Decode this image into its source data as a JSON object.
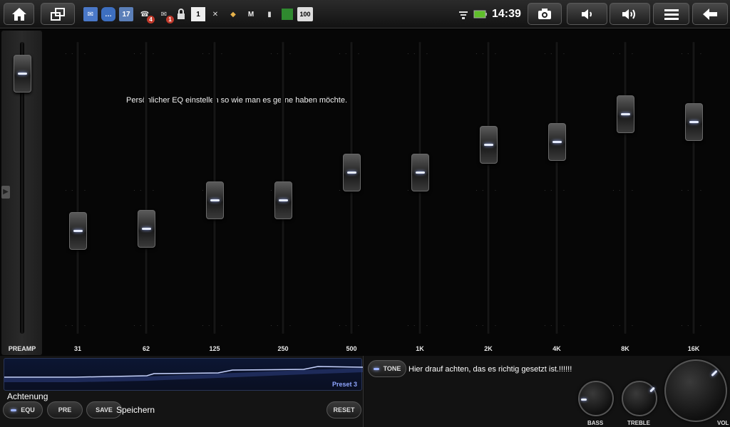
{
  "status_bar": {
    "clock": "14:39",
    "battery_level": "100",
    "notifications": [
      {
        "icon": "email-icon",
        "badge": ""
      },
      {
        "icon": "chat-icon",
        "badge": ""
      },
      {
        "icon": "calendar-icon",
        "badge": ""
      },
      {
        "icon": "missed-call-icon",
        "badge": "4"
      },
      {
        "icon": "message-icon",
        "badge": "1"
      },
      {
        "icon": "lock-icon",
        "badge": ""
      },
      {
        "icon": "box-icon",
        "badge": ""
      },
      {
        "icon": "voicemail-icon",
        "badge": ""
      },
      {
        "icon": "package-icon",
        "badge": ""
      },
      {
        "icon": "gmail-icon",
        "badge": ""
      },
      {
        "icon": "sd-card-icon",
        "badge": ""
      },
      {
        "icon": "green-square-icon",
        "badge": ""
      }
    ],
    "calendar_day": "17",
    "box_label": "1"
  },
  "equalizer": {
    "annotation": "Persönlicher  EQ  einstellen so wie man es gerne  haben möchte.",
    "preamp": {
      "label": "PREAMP",
      "level": 0.95
    },
    "bands": [
      {
        "label": "31",
        "level": 0.33
      },
      {
        "label": "62",
        "level": 0.34
      },
      {
        "label": "125",
        "level": 0.45
      },
      {
        "label": "250",
        "level": 0.45
      },
      {
        "label": "500",
        "level": 0.56
      },
      {
        "label": "1K",
        "level": 0.56
      },
      {
        "label": "2K",
        "level": 0.67
      },
      {
        "label": "4K",
        "level": 0.68
      },
      {
        "label": "8K",
        "level": 0.79
      },
      {
        "label": "16K",
        "level": 0.76
      }
    ]
  },
  "bottom_left": {
    "preset_label": "Preset 3",
    "annotation": "Achtenung",
    "buttons": {
      "equ": "EQU",
      "pre": "PRE",
      "save": "SAVE",
      "reset": "RESET"
    },
    "save_note": "Speichern"
  },
  "bottom_right": {
    "tone_button": "TONE",
    "annotation": "Hier drauf achten, das es richtig gesetzt ist.!!!!!!",
    "dials": {
      "bass": "BASS",
      "treble": "TREBLE",
      "vol": "VOL"
    }
  }
}
